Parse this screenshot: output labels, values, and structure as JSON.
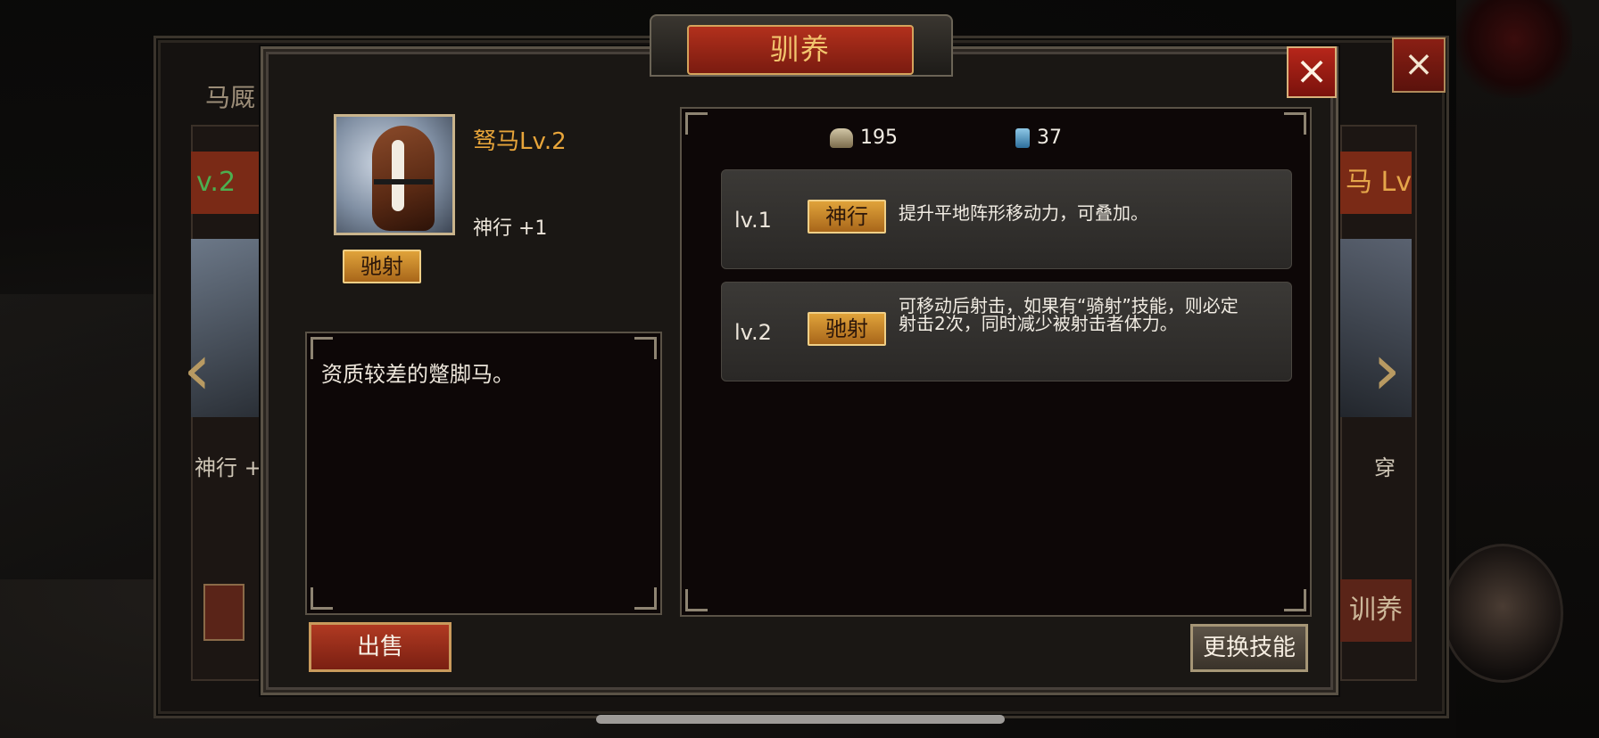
{
  "background": {
    "stable_tab": "马厩",
    "left_card": {
      "title": "v.2",
      "stat": "神行 +("
    },
    "right_card": {
      "title": "马 Lv",
      "stat": "穿",
      "button": "训养"
    }
  },
  "dialog": {
    "title": "驯养",
    "close_icon": "×",
    "horse": {
      "name": "驽马Lv.2",
      "skill_bonus": "神行 +1",
      "skill_tag": "驰射",
      "description": "资质较差的蹩脚马。"
    },
    "resources": [
      {
        "icon": "hay-icon",
        "value": "195"
      },
      {
        "icon": "whip-icon",
        "value": "37"
      }
    ],
    "skills": [
      {
        "level": "lv.1",
        "name": "神行",
        "description": "提升平地阵形移动力，可叠加。"
      },
      {
        "level": "lv.2",
        "name": "驰射",
        "description": "可移动后射击，如果有“骑射”技能，则必定射击2次，同时减少被射击者体力。"
      }
    ],
    "buttons": {
      "sell": "出售",
      "change_skill": "更换技能"
    }
  },
  "colors": {
    "accent_gold": "#e8a53a",
    "title_red": "#b2301c",
    "panel_bg": "#0d0707"
  }
}
